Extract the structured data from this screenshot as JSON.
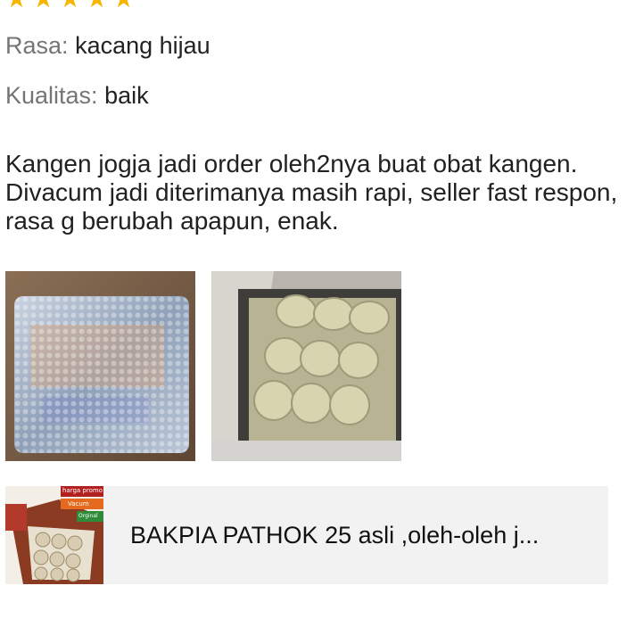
{
  "rating": {
    "value": 5,
    "max": 5,
    "star_color": "#f7b500"
  },
  "attributes": [
    {
      "key": "Rasa:",
      "value": "kacang hijau"
    },
    {
      "key": "Kualitas:",
      "value": "baik"
    }
  ],
  "review": {
    "text": "Kangen jogja  jadi order oleh2nya buat obat kangen. Divacum jadi diterimanya masih rapi, seller fast respon, rasa g berubah apapun, enak."
  },
  "photos": [
    {
      "icon": "bubble-wrapped-package-photo"
    },
    {
      "icon": "vacuum-packed-bakpia-box-photo"
    }
  ],
  "product": {
    "name": "BAKPIA PATHOK 25 asli ,oleh-oleh j...",
    "thumb_badges": [
      "harga promo",
      "Vacum",
      "Orginal"
    ]
  }
}
